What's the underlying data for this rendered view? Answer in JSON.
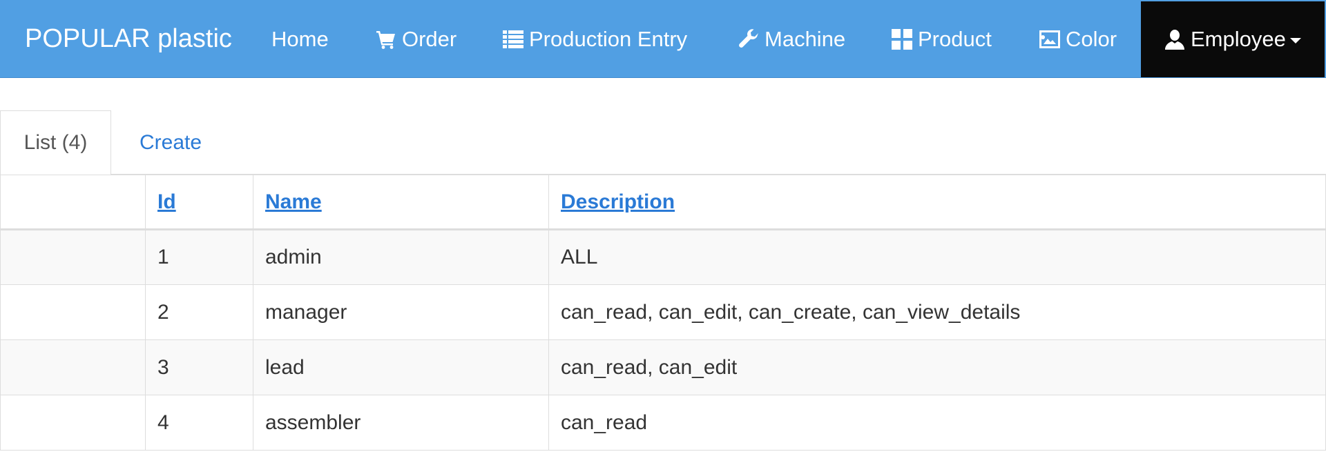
{
  "navbar": {
    "brand": "POPULAR plastic",
    "items": [
      {
        "label": "Home",
        "icon": ""
      },
      {
        "label": "Order",
        "icon": "shopping-cart-icon"
      },
      {
        "label": "Production Entry",
        "icon": "list-icon"
      },
      {
        "label": "Machine",
        "icon": "wrench-icon"
      },
      {
        "label": "Product",
        "icon": "grid-icon"
      },
      {
        "label": "Color",
        "icon": "image-icon"
      },
      {
        "label": "Employee",
        "icon": "user-icon"
      }
    ],
    "active_item": "Employee",
    "colors": {
      "background": "#519fe3",
      "active_background": "#0a0a0a"
    }
  },
  "tabs": {
    "list_label": "List (4)",
    "create_label": "Create"
  },
  "table": {
    "columns": [
      "",
      "Id",
      "Name",
      "Description"
    ],
    "rows": [
      {
        "id": "1",
        "name": "admin",
        "description": "ALL"
      },
      {
        "id": "2",
        "name": "manager",
        "description": "can_read, can_edit, can_create, can_view_details"
      },
      {
        "id": "3",
        "name": "lead",
        "description": "can_read, can_edit"
      },
      {
        "id": "4",
        "name": "assembler",
        "description": "can_read"
      }
    ]
  }
}
